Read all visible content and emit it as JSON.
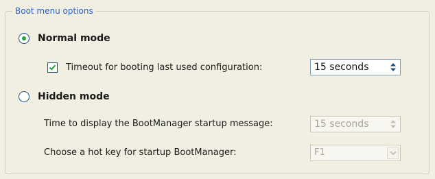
{
  "group": {
    "title": "Boot menu options"
  },
  "normal_mode": {
    "label": "Normal mode",
    "selected": true,
    "timeout_checkbox": {
      "label": "Timeout for booting last used configuration:",
      "checked": true
    },
    "timeout_spin": {
      "value": "15  seconds",
      "enabled": true
    }
  },
  "hidden_mode": {
    "label": "Hidden mode",
    "selected": false,
    "display_time": {
      "label": "Time to display the BootManager startup message:",
      "value": "15  seconds",
      "enabled": false
    },
    "hot_key": {
      "label": "Choose a hot key for startup BootManager:",
      "value": "F1",
      "enabled": false
    }
  },
  "colors": {
    "legend": "#2a5fc7",
    "radio_dot": "#22a33c",
    "check": "#22a33c",
    "disabled_text": "#a9a797"
  }
}
